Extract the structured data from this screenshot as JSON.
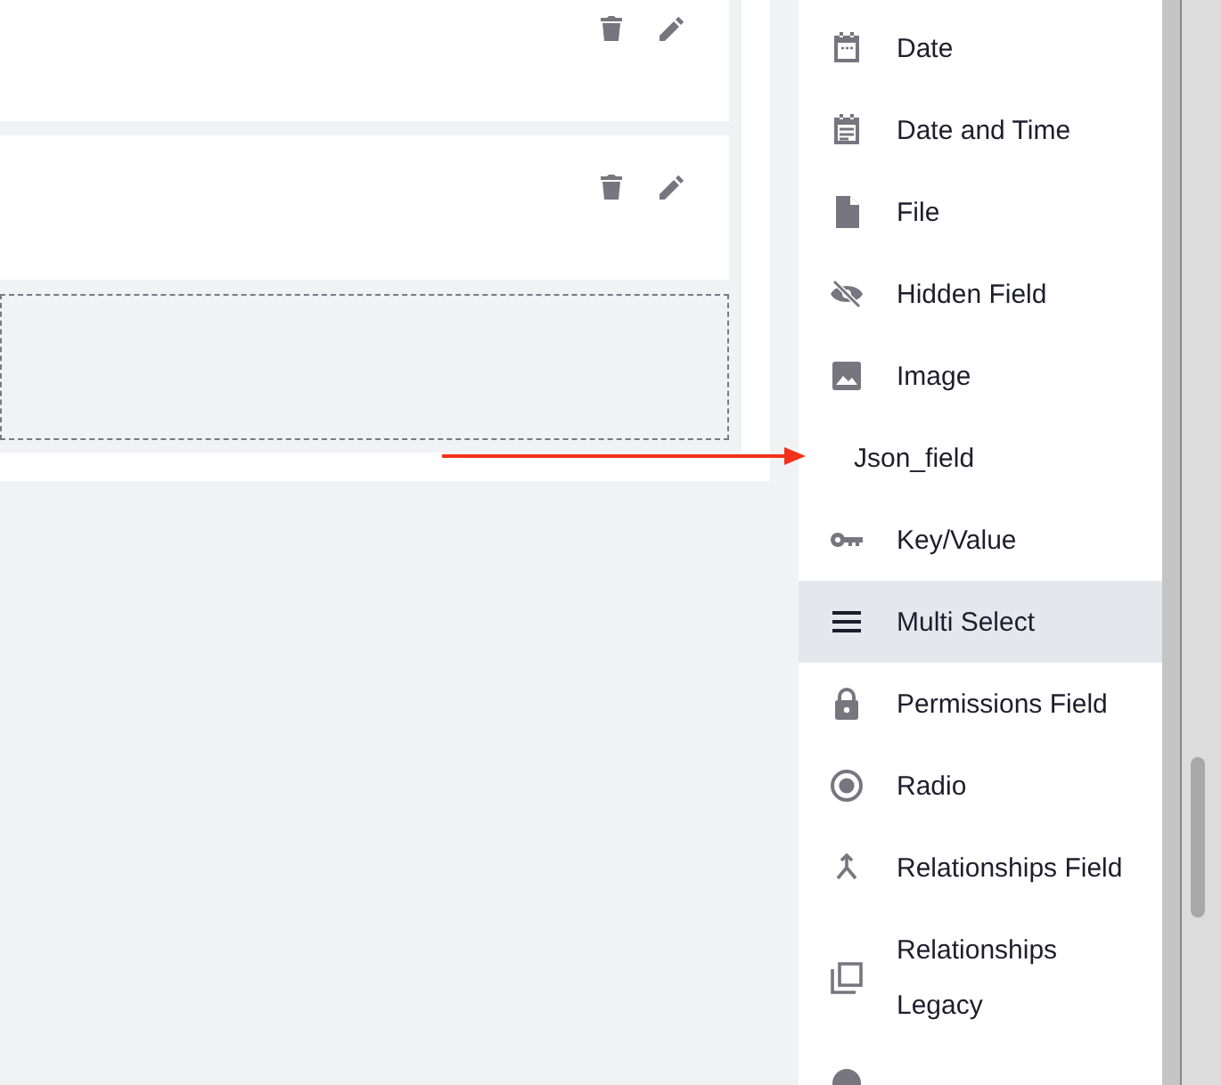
{
  "field_types": [
    {
      "label": "Date",
      "kind": "calendar",
      "selected": false
    },
    {
      "label": "Date and Time",
      "kind": "calendar-lines",
      "selected": false
    },
    {
      "label": "File",
      "kind": "file",
      "selected": false
    },
    {
      "label": "Hidden Field",
      "kind": "eye-off",
      "selected": false
    },
    {
      "label": "Image",
      "kind": "image",
      "selected": false
    },
    {
      "label": "Json_field",
      "kind": "none",
      "selected": false
    },
    {
      "label": "Key/Value",
      "kind": "key",
      "selected": false
    },
    {
      "label": "Multi Select",
      "kind": "lines",
      "selected": true
    },
    {
      "label": "Permissions Field",
      "kind": "lock",
      "selected": false
    },
    {
      "label": "Radio",
      "kind": "radio",
      "selected": false
    },
    {
      "label": "Relationships Field",
      "kind": "merge",
      "selected": false
    },
    {
      "label": "Relationships Legacy",
      "kind": "copy",
      "selected": false
    }
  ]
}
